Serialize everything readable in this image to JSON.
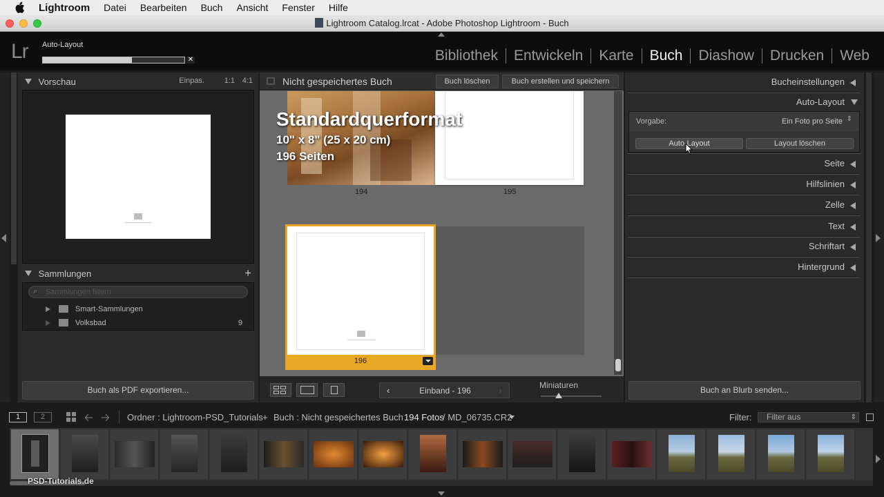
{
  "menubar": {
    "app_name": "Lightroom",
    "items": [
      "Datei",
      "Bearbeiten",
      "Buch",
      "Ansicht",
      "Fenster",
      "Hilfe"
    ]
  },
  "window": {
    "title": "Lightroom Catalog.lrcat - Adobe Photoshop Lightroom - Buch"
  },
  "identity": {
    "logo": "Lr",
    "status": "Auto-Layout",
    "progress": 0.63
  },
  "modules": {
    "items": [
      "Bibliothek",
      "Entwickeln",
      "Karte",
      "Buch",
      "Diashow",
      "Drucken",
      "Web"
    ],
    "active": "Buch"
  },
  "left_panel": {
    "preview": {
      "title": "Vorschau",
      "zoom_options": [
        "Einpas.",
        "1:1",
        "4:1"
      ]
    },
    "collections": {
      "title": "Sammlungen",
      "add_icon": "plus-icon",
      "search_placeholder": "Sammlungen filtern",
      "items": [
        {
          "label": "Smart-Sammlungen",
          "count": ""
        },
        {
          "label": "Volksbad",
          "count": "9"
        }
      ]
    },
    "export_button": "Buch als PDF exportieren..."
  },
  "center": {
    "book_title": "Nicht gespeichertes Buch",
    "delete_button": "Buch löschen",
    "create_button": "Buch erstellen und speichern",
    "overlay": {
      "format": "Standardquerformat",
      "size": "10\" x 8\" (25 x 20 cm)",
      "pages": "196 Seiten"
    },
    "page_numbers": [
      "194",
      "195",
      "196"
    ],
    "nav_label": "Einband - 196",
    "thumbnails_label": "Miniaturen",
    "thumbnail_size": 0.3
  },
  "right_panel": {
    "book_settings": "Bucheinstellungen",
    "auto_layout": {
      "title": "Auto-Layout",
      "preset_label": "Vorgabe:",
      "preset_value": "Ein Foto pro Seite",
      "auto_button": "Auto-Layout",
      "clear_button": "Layout löschen"
    },
    "sections": [
      "Seite",
      "Hilfslinien",
      "Zelle",
      "Text",
      "Schriftart",
      "Hintergrund"
    ],
    "blurb_button": "Buch an Blurb senden..."
  },
  "filmbar": {
    "screen1": "1",
    "screen2": "2",
    "source": "Ordner : Lightroom-PSD_Tutorials",
    "plus": "+",
    "book": "Buch : Nicht gespeichertes Buch",
    "count": "194 Fotos",
    "filename": "/ MD_06735.CR2",
    "filter_label": "Filter:",
    "filter_value": "Filter aus"
  },
  "watermark": "PSD-Tutorials.de",
  "colors": {
    "accent": "#e8a823",
    "panel": "#2a2a2a",
    "canvas": "#6b6b6b"
  }
}
